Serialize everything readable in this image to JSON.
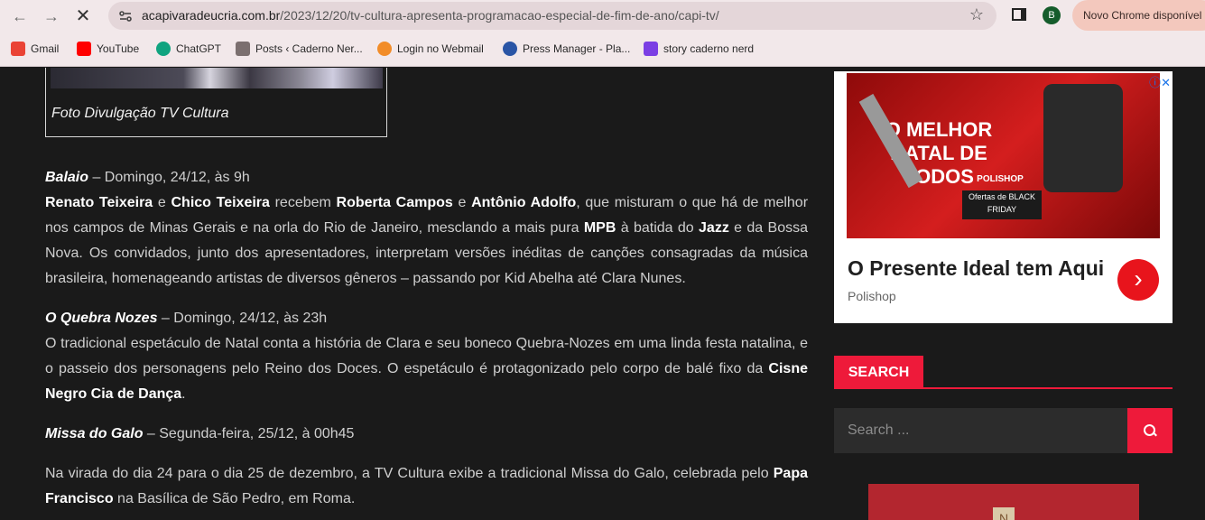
{
  "browser": {
    "url_host": "acapivaradeucria.com.br",
    "url_path": "/2023/12/20/tv-cultura-apresenta-programacao-especial-de-fim-de-ano/capi-tv/",
    "profile_initial": "B",
    "update_label": "Novo Chrome disponível"
  },
  "bookmarks": [
    {
      "label": "Gmail",
      "icon": "gmail-icon",
      "color": "#ea4335"
    },
    {
      "label": "YouTube",
      "icon": "youtube-icon",
      "color": "#ff0000"
    },
    {
      "label": "ChatGPT",
      "icon": "chatgpt-icon",
      "color": "#10a37f"
    },
    {
      "label": "Posts ‹ Caderno Ner...",
      "icon": "wordpress-icon",
      "color": "#7b6f6f"
    },
    {
      "label": "Login no Webmail",
      "icon": "webmail-icon",
      "color": "#f28c28"
    },
    {
      "label": "Press Manager - Pla...",
      "icon": "press-manager-icon",
      "color": "#2a55a5"
    },
    {
      "label": "story caderno nerd",
      "icon": "story-icon",
      "color": "#7b3fe4"
    }
  ],
  "figure": {
    "caption": "Foto Divulgação TV Cultura"
  },
  "article": {
    "p1": {
      "title": "Balaio",
      "meta": " – Domingo, 24/12, às 9h",
      "n1": "Renato Teixeira",
      "t1": " e ",
      "n2": "Chico Teixeira",
      "t2": " recebem ",
      "n3": "Roberta Campos",
      "t3": " e ",
      "n4": "Antônio Adolfo",
      "t4": ", que misturam o que há de melhor nos campos de Minas Gerais e na orla do Rio de Janeiro, mesclando a mais pura ",
      "n5": "MPB",
      "t5": " à batida do ",
      "n6": "Jazz",
      "t6": " e da Bossa Nova. Os convidados, junto dos apresentadores, interpretam versões inéditas de canções consagradas da música brasileira, homenageando artistas de diversos gêneros – passando por Kid Abelha até Clara Nunes."
    },
    "p2": {
      "title": "O Quebra Nozes",
      "meta": " – Domingo, 24/12, às 23h",
      "t1": "O tradicional espetáculo de Natal conta a história de Clara e seu boneco Quebra-Nozes em uma linda festa natalina, e o passeio dos personagens pelo Reino dos Doces. O espetáculo é protagonizado pelo corpo de balé fixo da ",
      "n1": "Cisne Negro Cia de Dança",
      "t2": "."
    },
    "p3": {
      "title": "Missa do Galo",
      "meta": " – Segunda-feira, 25/12, à 00h45"
    },
    "p4": {
      "t1": "Na virada do dia 24 para o dia 25 de dezembro, a TV Cultura exibe a tradicional Missa do Galo, celebrada pelo ",
      "n1": "Papa Francisco",
      "t2": " na Basílica de São Pedro, em Roma."
    }
  },
  "ad": {
    "promo_title": "O MELHOR NATAL DE TODOS",
    "promo_brand": "POLISHOP",
    "promo_box": "Ofertas de BLACK FRIDAY",
    "headline": "O Presente Ideal tem Aqui",
    "advertiser": "Polishop"
  },
  "sidebar": {
    "search_heading": "SEARCH",
    "search_placeholder": "Search ..."
  }
}
